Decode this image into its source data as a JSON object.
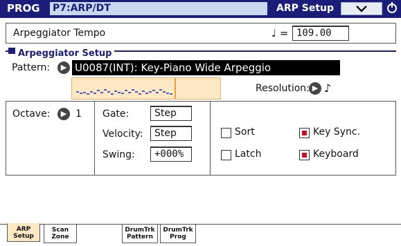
{
  "titlebar": {
    "mode": "PROG",
    "program": "P7:ARP/DT",
    "page": "ARP Setup"
  },
  "tempo": {
    "label": "Arpeggiator Tempo",
    "note_symbol": "♩ =",
    "value": "109.00"
  },
  "section": {
    "title": "Arpeggiator Setup"
  },
  "pattern": {
    "label": "Pattern:",
    "value": "U0087(INT): Key-Piano Wide Arpeggio"
  },
  "resolution": {
    "label": "Resolution:",
    "value": "♪"
  },
  "octave": {
    "label": "Octave:",
    "value": "1"
  },
  "gate": {
    "label": "Gate:",
    "value": "Step"
  },
  "velocity": {
    "label": "Velocity:",
    "value": "Step"
  },
  "swing": {
    "label": "Swing:",
    "value": "+000%"
  },
  "checkboxes": {
    "sort": {
      "label": "Sort",
      "checked": false
    },
    "latch": {
      "label": "Latch",
      "checked": false
    },
    "key_sync": {
      "label": "Key Sync.",
      "checked": true
    },
    "keyboard": {
      "label": "Keyboard",
      "checked": true
    }
  },
  "tabs": [
    {
      "line1": "ARP",
      "line2": "Setup",
      "active": true
    },
    {
      "line1": "Scan",
      "line2": "Zone",
      "active": false
    },
    {
      "line1": "DrumTrk",
      "line2": "Pattern",
      "active": false
    },
    {
      "line1": "DrumTrk",
      "line2": "Prog",
      "active": false
    }
  ],
  "colors": {
    "title_bar": "#1a1e78",
    "accent_preview": "#fde8c4",
    "check_on": "#c8102e"
  }
}
